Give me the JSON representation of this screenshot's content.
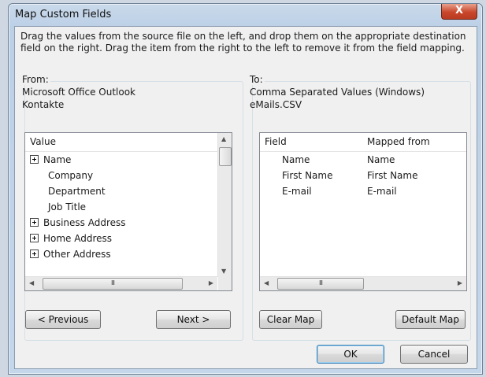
{
  "window": {
    "title": "Map Custom Fields",
    "close_glyph": "X"
  },
  "instructions": "Drag the values from the source file on the left, and drop them on the appropriate destination field on the right.  Drag the item from the right to the left to remove it from the field mapping.",
  "from": {
    "caption": "From:",
    "source_app": "Microsoft Office Outlook",
    "source_folder": "Kontakte",
    "column_header": "Value",
    "items": [
      {
        "label": "Name",
        "expandable": true
      },
      {
        "label": "Company",
        "expandable": false
      },
      {
        "label": "Department",
        "expandable": false
      },
      {
        "label": "Job Title",
        "expandable": false
      },
      {
        "label": "Business Address",
        "expandable": true
      },
      {
        "label": "Home Address",
        "expandable": true
      },
      {
        "label": "Other Address",
        "expandable": true
      }
    ],
    "hscroll_grip": "III",
    "previous_label": "< Previous",
    "next_label": "Next >"
  },
  "to": {
    "caption": "To:",
    "target_format": "Comma Separated Values (Windows)",
    "target_file": "eMails.CSV",
    "headers": {
      "field": "Field",
      "mapped_from": "Mapped from"
    },
    "rows": [
      {
        "field": "Name",
        "mapped_from": "Name"
      },
      {
        "field": "First Name",
        "mapped_from": "First Name"
      },
      {
        "field": "E-mail",
        "mapped_from": "E-mail"
      }
    ],
    "hscroll_grip": "III",
    "clear_map_label": "Clear Map",
    "default_map_label": "Default Map"
  },
  "footer": {
    "ok_label": "OK",
    "cancel_label": "Cancel"
  }
}
